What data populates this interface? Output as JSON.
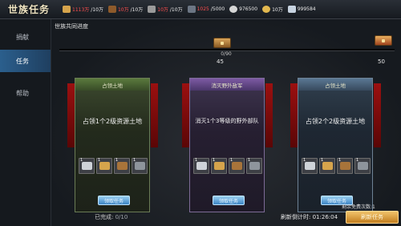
{
  "header": {
    "title": "世族任务",
    "resources": [
      {
        "icon": "wheat-icon",
        "value": "1113万",
        "cap": "/10万",
        "value_color": "#ff4e4e"
      },
      {
        "icon": "wood-icon",
        "value": "10万",
        "cap": "/10万",
        "value_color": "#ff4e4e"
      },
      {
        "icon": "stone-icon",
        "value": "10万",
        "cap": "/10万",
        "value_color": "#ff4e4e"
      },
      {
        "icon": "iron-icon",
        "value": "1025",
        "cap": "/5000",
        "value_color": "#ff4e4e"
      },
      {
        "icon": "silver-icon",
        "value": "976500",
        "cap": ""
      },
      {
        "icon": "coin-icon",
        "value": "10万",
        "cap": ""
      },
      {
        "icon": "gem-icon",
        "value": "999584",
        "cap": ""
      }
    ]
  },
  "sidebar": {
    "items": [
      {
        "label": "捐献"
      },
      {
        "label": "任务"
      },
      {
        "label": "帮助"
      }
    ],
    "active_index": 1
  },
  "progress": {
    "title": "世族共同进度",
    "count": "0/90",
    "fraction": 0,
    "milestones": [
      "45",
      "50"
    ]
  },
  "tasks": [
    {
      "title": "占领土地",
      "description": "占领1个2级资源土地",
      "button": "领取任务",
      "theme": "green",
      "rewards": [
        {
          "qty": "1"
        },
        {
          "qty": "1"
        },
        {
          "qty": "1"
        },
        {
          "qty": "1"
        }
      ]
    },
    {
      "title": "消灭野外敌军",
      "description": "消灭1个3等级的野外部队",
      "button": "领取任务",
      "theme": "purple",
      "rewards": [
        {
          "qty": "1"
        },
        {
          "qty": "1"
        },
        {
          "qty": "1"
        },
        {
          "qty": "1"
        }
      ]
    },
    {
      "title": "占领土地",
      "description": "占领2个2级资源土地",
      "button": "领取任务",
      "theme": "blue",
      "rewards": [
        {
          "qty": "1"
        },
        {
          "qty": "1"
        },
        {
          "qty": "1"
        },
        {
          "qty": "1"
        }
      ]
    }
  ],
  "footer": {
    "completed_label": "已完成:",
    "completed_value": "0/10",
    "refresh_count_label": "剩余免费次数:1",
    "refresh_time_label": "刷新倒计时:",
    "refresh_time": "01:26:04",
    "refresh_button": "刷新任务"
  },
  "colors": {
    "accent_blue": "#2b5f8d",
    "gold": "#c99a40",
    "danger": "#ff4e4e"
  }
}
